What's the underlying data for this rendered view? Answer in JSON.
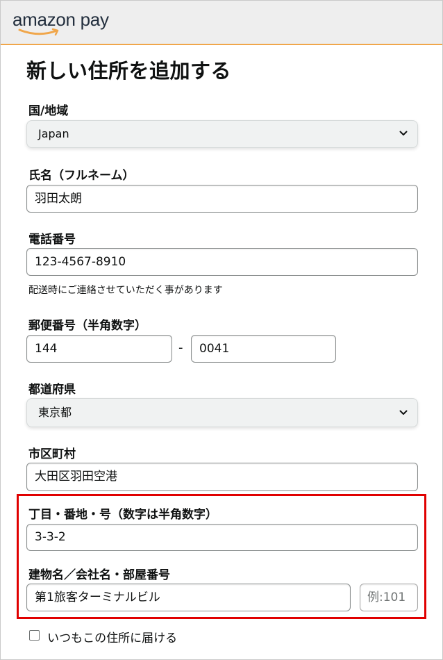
{
  "header": {
    "logo_text": "amazon pay",
    "logo_icon": "amazon-smile",
    "border_color": "#f0a64a"
  },
  "page": {
    "title": "新しい住所を追加する"
  },
  "form": {
    "country": {
      "label": "国/地域",
      "value": "Japan",
      "icon": "chevron-down"
    },
    "name": {
      "label": "氏名（フルネーム）",
      "value": "羽田太朗"
    },
    "phone": {
      "label": "電話番号",
      "value": "123-4567-8910",
      "hint": "配送時にご連絡させていただく事があります"
    },
    "postal": {
      "label": "郵便番号（半角数字）",
      "value1": "144",
      "separator": "-",
      "value2": "0041"
    },
    "prefecture": {
      "label": "都道府県",
      "value": "東京都",
      "icon": "chevron-down"
    },
    "city": {
      "label": "市区町村",
      "value": "大田区羽田空港"
    },
    "address1": {
      "label": "丁目・番地・号（数字は半角数字）",
      "value": "3-3-2"
    },
    "address2": {
      "label": "建物名／会社名・部屋番号",
      "value": "第1旅客ターミナルビル",
      "room_placeholder": "例:101"
    },
    "default_checkbox": {
      "label": "いつもこの住所に届ける",
      "checked": false
    }
  },
  "highlight_color": "#e00000"
}
